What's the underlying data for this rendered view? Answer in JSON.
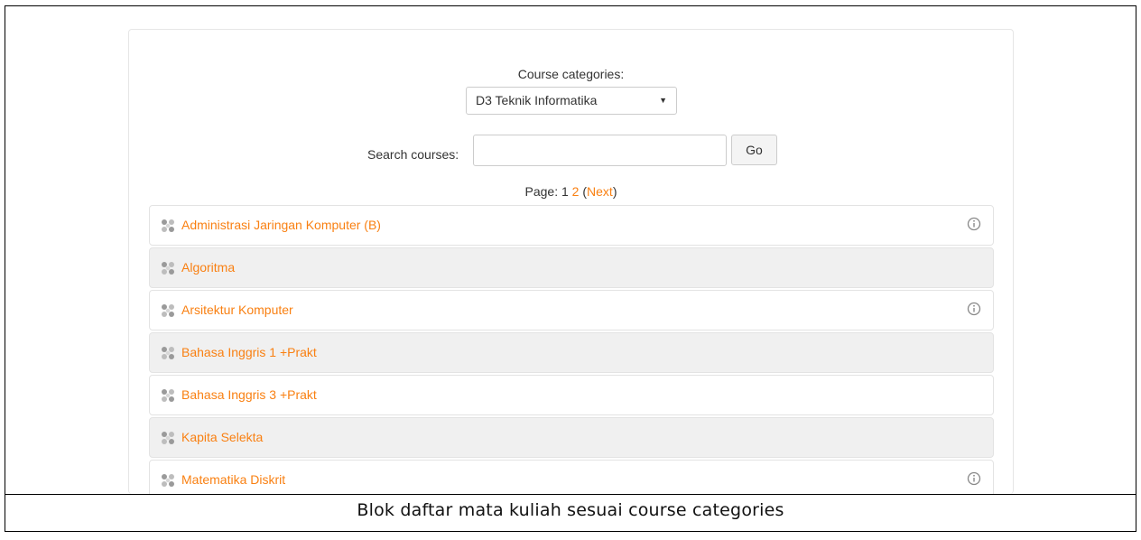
{
  "categories": {
    "label": "Course categories:",
    "selected": "D3 Teknik Informatika"
  },
  "search": {
    "label": "Search courses:",
    "value": "",
    "go_label": "Go"
  },
  "paging": {
    "prefix": "Page:",
    "current": "1",
    "next_page": "2",
    "next_label": "Next"
  },
  "courses": [
    {
      "name": "Administrasi Jaringan Komputer (B)",
      "info": true
    },
    {
      "name": "Algoritma",
      "info": false
    },
    {
      "name": "Arsitektur Komputer",
      "info": true
    },
    {
      "name": "Bahasa Inggris 1 +Prakt",
      "info": false
    },
    {
      "name": "Bahasa Inggris 3 +Prakt",
      "info": false
    },
    {
      "name": "Kapita Selekta",
      "info": false
    },
    {
      "name": "Matematika Diskrit",
      "info": true
    }
  ],
  "caption": "Blok daftar mata kuliah sesuai course categories",
  "colors": {
    "link": "#f98012",
    "alt_row": "#f0f0f0",
    "border": "#e3e3e3"
  },
  "icons": {
    "course": "course-icon",
    "info": "info-icon",
    "caret": "caret-down-icon"
  }
}
